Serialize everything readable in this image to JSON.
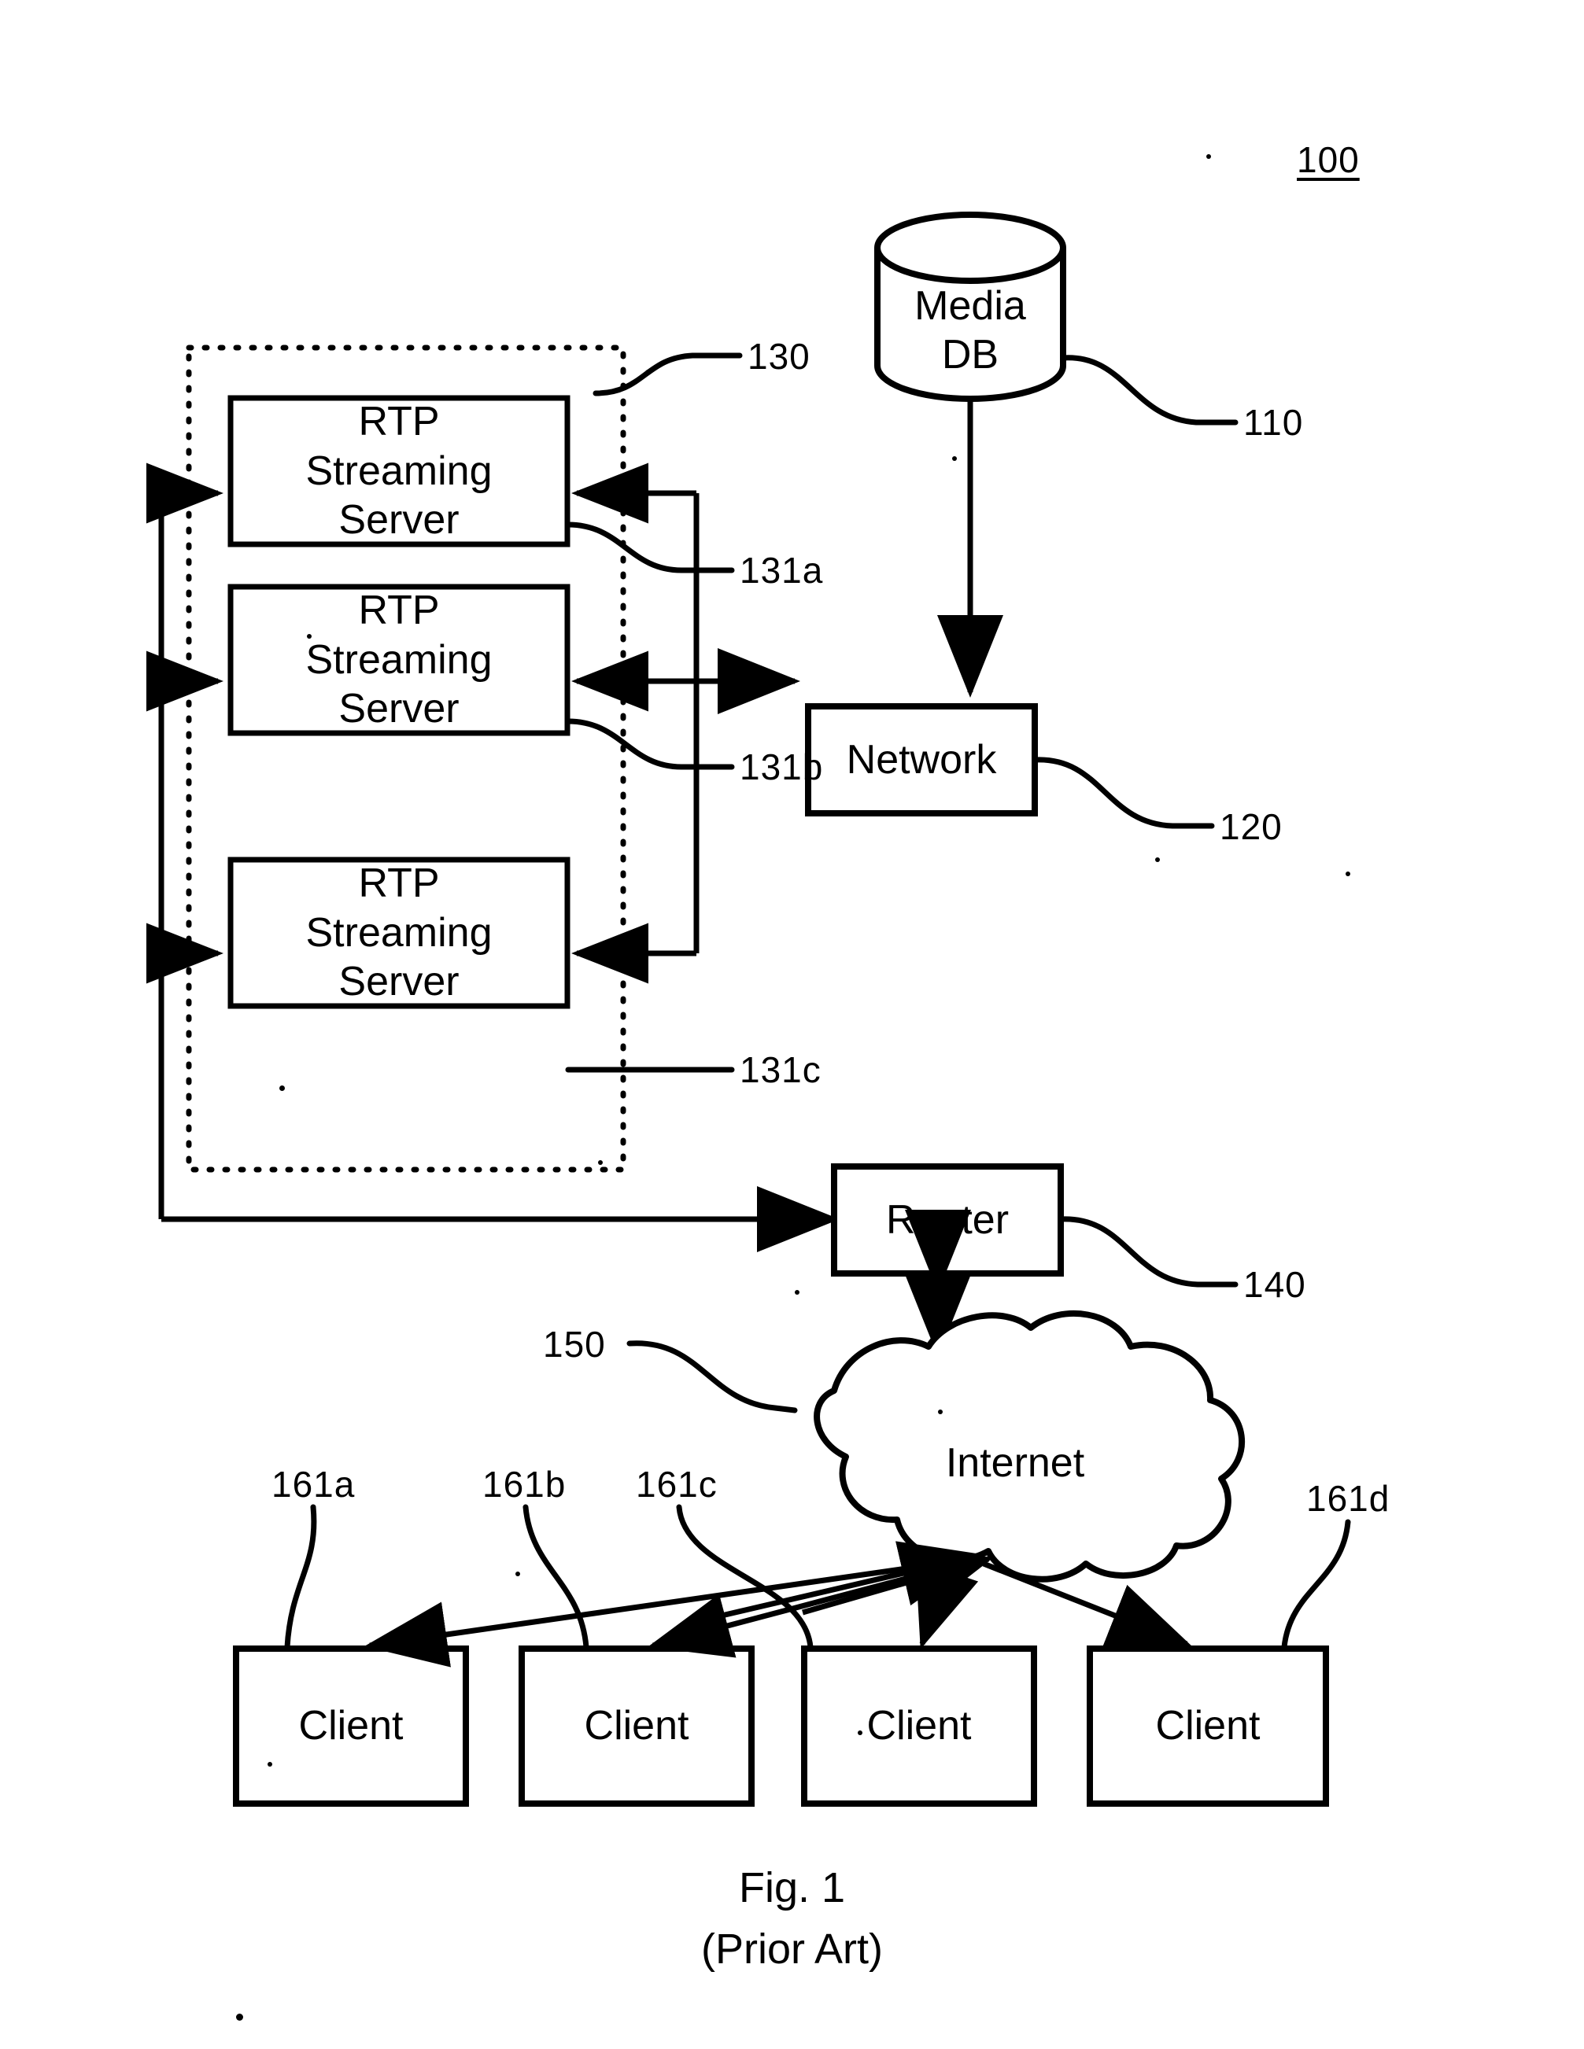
{
  "figure": {
    "system_ref": "100",
    "caption_line1": "Fig. 1",
    "caption_line2": "(Prior Art)"
  },
  "nodes": {
    "media_db": {
      "line1": "Media",
      "line2": "DB",
      "ref": "110"
    },
    "network": {
      "label": "Network",
      "ref": "120"
    },
    "server_group": {
      "ref": "130"
    },
    "servers": [
      {
        "line1": "RTP",
        "line2": "Streaming",
        "line3": "Server",
        "ref": "131a"
      },
      {
        "line1": "RTP",
        "line2": "Streaming",
        "line3": "Server",
        "ref": "131b"
      },
      {
        "line1": "RTP",
        "line2": "Streaming",
        "line3": "Server",
        "ref": "131c"
      }
    ],
    "router": {
      "label": "Router",
      "ref": "140"
    },
    "internet": {
      "label": "Internet",
      "ref": "150"
    },
    "clients": [
      {
        "label": "Client",
        "ref": "161a"
      },
      {
        "label": "Client",
        "ref": "161b"
      },
      {
        "label": "Client",
        "ref": "161c"
      },
      {
        "label": "Client",
        "ref": "161d"
      }
    ]
  },
  "colors": {
    "ink": "#000000",
    "paper": "#ffffff"
  }
}
